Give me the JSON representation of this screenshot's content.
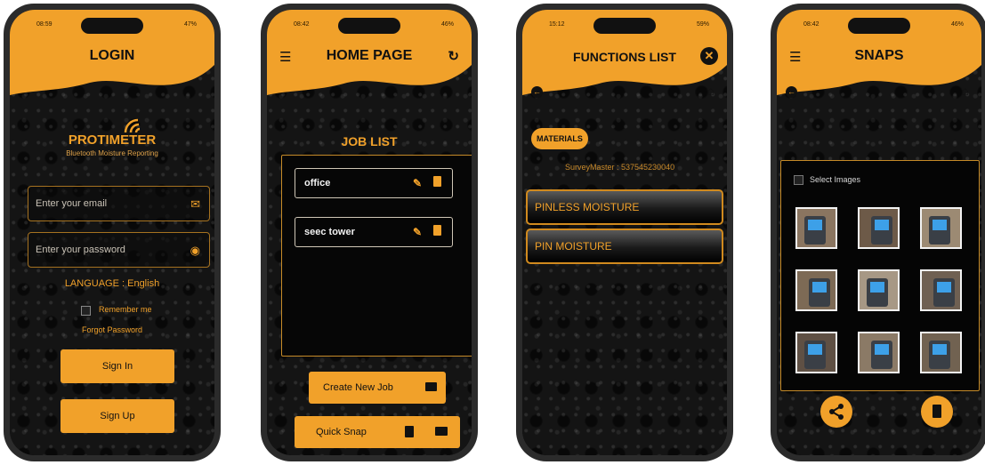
{
  "colors": {
    "accent": "#f1a12a",
    "background": "#0c0c0c",
    "card_border": "#c58a28"
  },
  "phones": {
    "login": {
      "status_time": "08:59",
      "status_right": "47%",
      "title": "LOGIN",
      "brand": "PROTIMETER",
      "tagline": "Bluetooth Moisture Reporting",
      "email_placeholder": "Enter your email",
      "password_placeholder": "Enter your password",
      "language_label": "LANGUAGE : English",
      "remember_label": "Remember me",
      "forgot_label": "Forgot Password",
      "signin_label": "Sign In",
      "signup_label": "Sign Up",
      "icons": [
        "envelope-icon",
        "eye-icon",
        "wifi-arc-logo-icon"
      ]
    },
    "home": {
      "status_time": "08:42",
      "status_right": "46%",
      "title": "HOME PAGE",
      "section_title": "JOB LIST",
      "jobs": [
        {
          "name": "office"
        },
        {
          "name": "seec tower"
        }
      ],
      "create_label": "Create New Job",
      "quick_label": "Quick Snap",
      "icons": [
        "hamburger-menu-icon",
        "refresh-icon",
        "pencil-icon",
        "trash-icon",
        "folder-plus-icon",
        "save-icon",
        "folder-icon"
      ]
    },
    "functions": {
      "status_time": "15:12",
      "status_right": "59%",
      "title": "FUNCTIONS LIST",
      "chip_label": "MATERIALS",
      "survey_label": "SurveyMaster : 537545230040",
      "items": [
        "PINLESS MOISTURE",
        "PIN MOISTURE"
      ],
      "icons": [
        "close-icon",
        "back-arrow-icon",
        "home-icon"
      ]
    },
    "snaps": {
      "status_time": "08:42",
      "status_right": "46%",
      "title": "SNAPS",
      "select_label": "Select Images",
      "image_count": 9,
      "icons": [
        "hamburger-menu-icon",
        "back-arrow-icon",
        "home-icon",
        "share-icon",
        "trash-icon"
      ]
    }
  }
}
